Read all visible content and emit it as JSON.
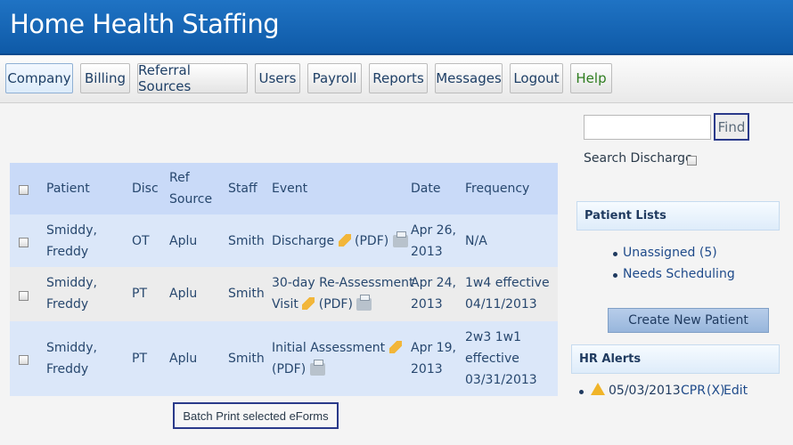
{
  "header": {
    "title": "Home Health Staffing"
  },
  "nav": {
    "company": "Company",
    "billing": "Billing",
    "referral_sources": "Referral Sources",
    "users": "Users",
    "payroll": "Payroll",
    "reports": "Reports",
    "messages": "Messages",
    "logout": "Logout",
    "help": "Help"
  },
  "table": {
    "headers": {
      "patient": "Patient",
      "disc": "Disc",
      "ref_source_1": "Ref",
      "ref_source_2": "Source",
      "staff": "Staff",
      "event": "Event",
      "date": "Date",
      "frequency": "Frequency"
    },
    "rows": [
      {
        "patient_1": "Smiddy,",
        "patient_2": "Freddy",
        "disc": "OT",
        "ref": "Aplu",
        "staff": "Smith",
        "event_1": "Discharge",
        "event_2": "",
        "pdf": "(PDF)",
        "date_1": "Apr 26,",
        "date_2": "2013",
        "freq_1": "N/A",
        "freq_2": "",
        "freq_3": ""
      },
      {
        "patient_1": "Smiddy,",
        "patient_2": "Freddy",
        "disc": "PT",
        "ref": "Aplu",
        "staff": "Smith",
        "event_1": "30-day Re-Assessment",
        "event_2": "Visit",
        "pdf": "(PDF)",
        "date_1": "Apr 24,",
        "date_2": "2013",
        "freq_1": "1w4 effective",
        "freq_2": "04/11/2013",
        "freq_3": ""
      },
      {
        "patient_1": "Smiddy,",
        "patient_2": "Freddy",
        "disc": "PT",
        "ref": "Aplu",
        "staff": "Smith",
        "event_1": "Initial Assessment",
        "event_2": "",
        "pdf": "(PDF)",
        "date_1": "Apr 19,",
        "date_2": "2013",
        "freq_1": "2w3 1w1",
        "freq_2": "effective",
        "freq_3": "03/31/2013"
      }
    ]
  },
  "batch_print": "Batch Print selected eForms",
  "search": {
    "value": "",
    "find_label": "Find",
    "discharge_label": "Search Discharge"
  },
  "patient_lists": {
    "title": "Patient Lists",
    "items": [
      "Unassigned (5)",
      "Needs Scheduling"
    ]
  },
  "create_patient": "Create New Patient",
  "hr_alerts": {
    "title": "HR Alerts",
    "date": "05/03/2013",
    "type": "CPR",
    "remove": "(X)",
    "edit": "Edit"
  },
  "colors": {
    "header": "#0f5aa7",
    "row_alt": "#dbe7f9",
    "row_plain": "#ececec",
    "warning": "#f0b429"
  }
}
